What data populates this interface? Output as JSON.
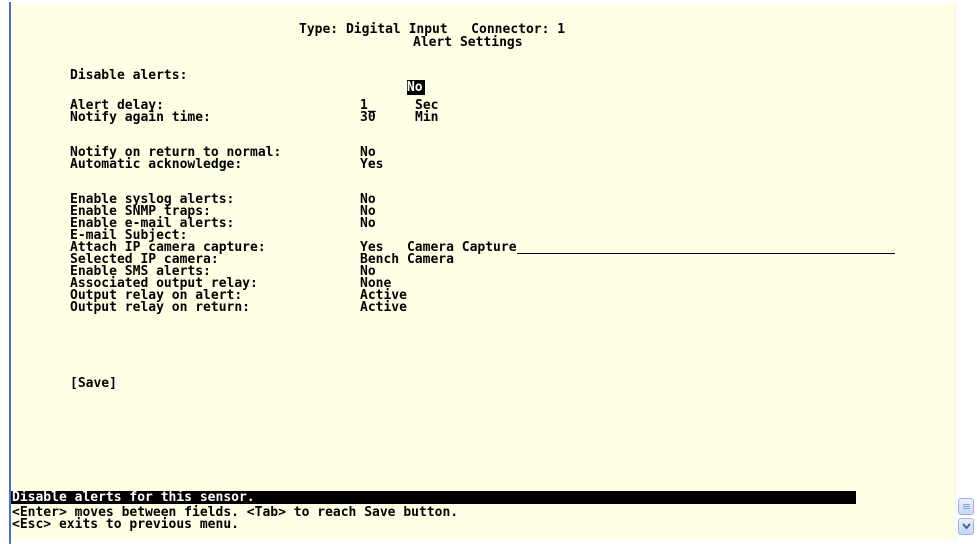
{
  "header": {
    "line1": "Type: Digital Input   Connector: 1",
    "line2": "Alert Settings"
  },
  "fields": [
    {
      "label": "Disable alerts:",
      "value": "No",
      "unit": ""
    },
    {
      "label": "Alert delay:",
      "value": "1_",
      "unit": "Sec"
    },
    {
      "label": "Notify again time:",
      "value": "30",
      "unit": "Min"
    },
    {
      "label": "Notify on return to normal:",
      "value": "No",
      "unit": ""
    },
    {
      "label": "Automatic acknowledge:",
      "value": "Yes",
      "unit": ""
    },
    {
      "label": "Enable syslog alerts:",
      "value": "No",
      "unit": ""
    },
    {
      "label": "Enable SNMP traps:",
      "value": "No",
      "unit": ""
    },
    {
      "label": "Enable e-mail alerts:",
      "value": "No",
      "unit": ""
    },
    {
      "label": "E-mail Subject:",
      "value": "Camera Capture",
      "unit": ""
    },
    {
      "label": "Attach IP camera capture:",
      "value": "Yes",
      "unit": ""
    },
    {
      "label": "Selected IP camera:",
      "value": "Bench Camera",
      "unit": ""
    },
    {
      "label": "Enable SMS alerts:",
      "value": "No",
      "unit": ""
    },
    {
      "label": "Associated output relay:",
      "value": "None",
      "unit": ""
    },
    {
      "label": "Output relay on alert:",
      "value": "Active",
      "unit": ""
    },
    {
      "label": "Output relay on return:",
      "value": "Active",
      "unit": ""
    }
  ],
  "save_label": "[Save]",
  "status": {
    "help": "Disable alerts for this sensor.",
    "hint1": "<Enter> moves between fields. <Tab> to reach Save button.",
    "hint2": "<Esc> exits to previous menu."
  },
  "colors": {
    "terminal_bg": "#ffffe6",
    "text": "#000000",
    "highlight_bg": "#000000",
    "highlight_text": "#ffffff",
    "border_accent": "#4a6fd8"
  }
}
